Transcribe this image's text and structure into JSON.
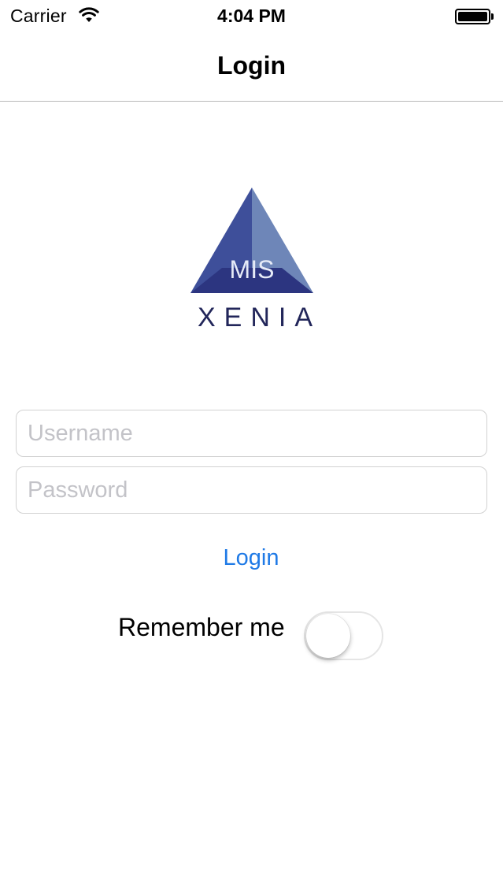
{
  "status_bar": {
    "carrier": "Carrier",
    "time": "4:04 PM",
    "wifi_icon": "wifi-icon",
    "battery_icon": "battery-full-icon"
  },
  "nav": {
    "title": "Login"
  },
  "logo": {
    "mark_text": "MIS",
    "wordmark": "XENIA",
    "colors": {
      "dark": "#2c3580",
      "mid": "#3e4f9a",
      "light": "#6e86b8",
      "text": "#22265a"
    }
  },
  "form": {
    "username_placeholder": "Username",
    "username_value": "",
    "password_placeholder": "Password",
    "password_value": "",
    "login_label": "Login",
    "remember_label": "Remember me",
    "remember_on": false
  },
  "colors": {
    "accent": "#1f7ae6",
    "placeholder": "#c3c3c8",
    "border": "#d2d2d2"
  }
}
